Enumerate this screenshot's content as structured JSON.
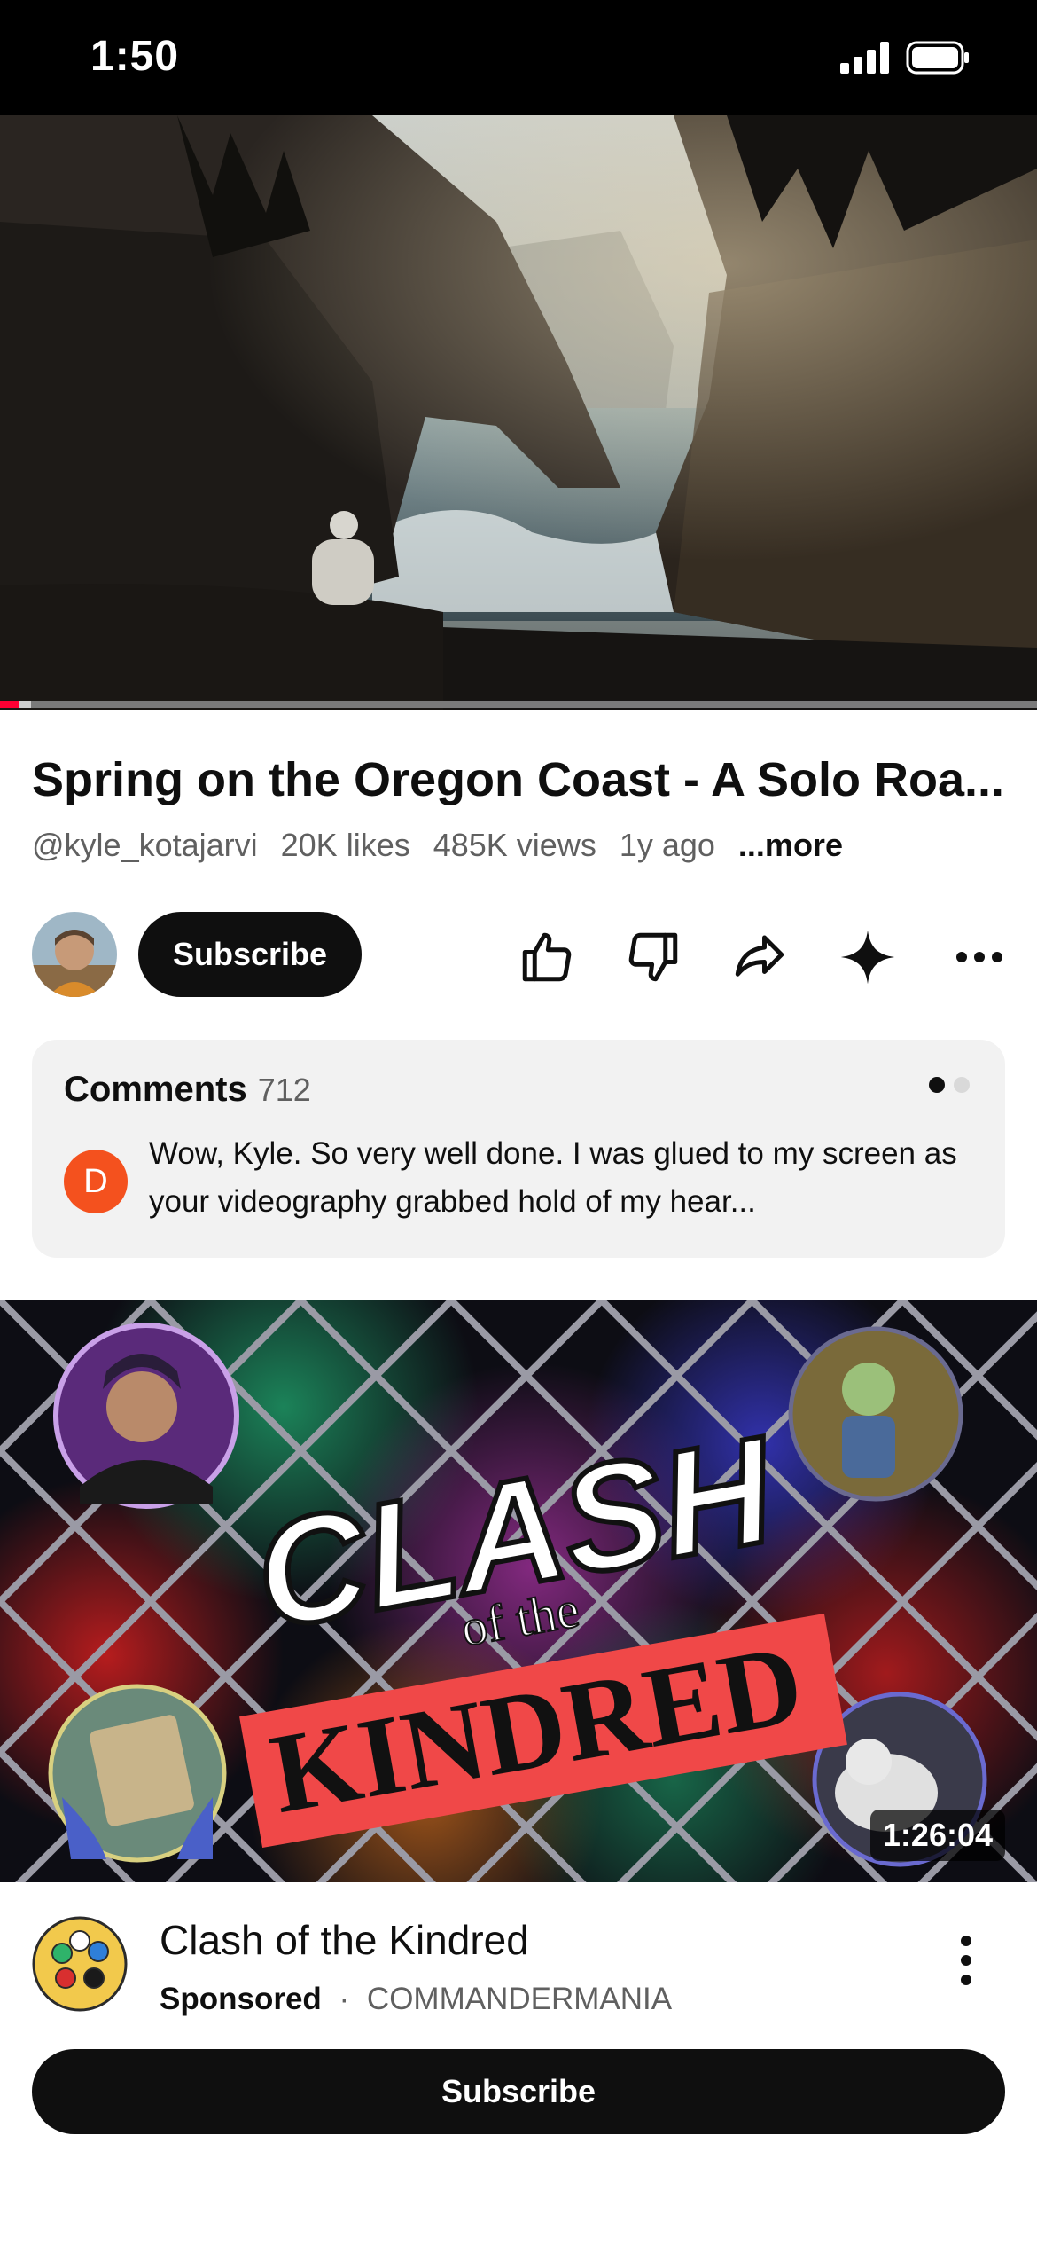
{
  "status_bar": {
    "time": "1:50"
  },
  "player": {
    "progress": 0.018,
    "buffered": 0.03
  },
  "video": {
    "title": "Spring on the Oregon Coast - A Solo Roa...",
    "channel_handle": "@kyle_kotajarvi",
    "likes": "20K likes",
    "views": "485K views",
    "age": "1y ago",
    "more_label": "...more"
  },
  "channel": {
    "subscribe_label": "Subscribe"
  },
  "actions": [
    "like-icon",
    "dislike-icon",
    "share-icon",
    "sparkle-icon",
    "more-horizontal-icon"
  ],
  "comments": {
    "title": "Comments",
    "count": "712",
    "avatar_letter": "D",
    "avatar_color": "#f4511e",
    "preview_text": "Wow, Kyle.  So very well done.  I was glued to my screen as your videography grabbed hold of my hear..."
  },
  "ad": {
    "thumb_title_line1": "CLASH",
    "thumb_title_line2": "of the",
    "thumb_title_line3": "KINDRED",
    "duration": "1:26:04",
    "title": "Clash of the Kindred",
    "sponsored_label": "Sponsored",
    "separator": "·",
    "advertiser": "COMMANDERMANIA",
    "subscribe_label": "Subscribe"
  },
  "colors": {
    "accent": "#ff0033",
    "primary_text": "#0f0f0f",
    "secondary_text": "#606060",
    "card_bg": "#f2f2f2",
    "kindred_red": "#f04848"
  }
}
